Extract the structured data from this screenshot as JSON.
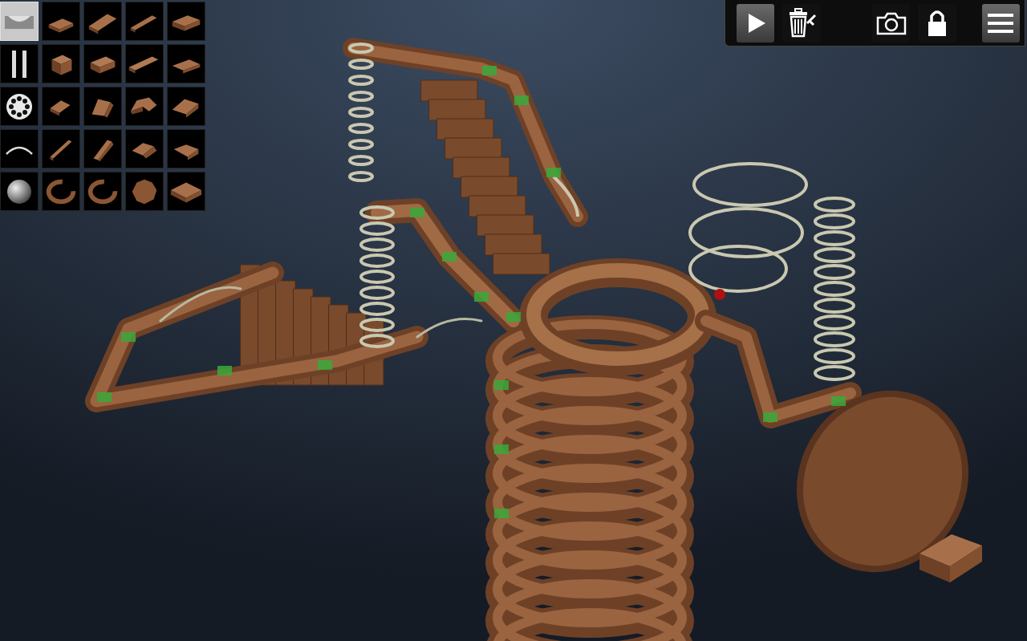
{
  "palette": {
    "categories": [
      {
        "kind": "track",
        "selected": true
      },
      {
        "kind": "rails",
        "selected": false
      },
      {
        "kind": "wheel",
        "selected": false
      },
      {
        "kind": "wire",
        "selected": false
      },
      {
        "kind": "ball",
        "selected": false
      }
    ],
    "pieces": [
      [
        "slab",
        "ramp",
        "bar",
        "tray"
      ],
      [
        "cube",
        "block",
        "beam",
        "wedge"
      ],
      [
        "corner",
        "bend",
        "arc",
        "fork"
      ],
      [
        "stick",
        "chute",
        "step",
        "spout"
      ],
      [
        "ring",
        "ring",
        "disc",
        "funnel"
      ]
    ]
  },
  "toolbar": {
    "buttons": [
      {
        "kind": "play",
        "active": false
      },
      {
        "kind": "trash",
        "active": false
      },
      {
        "kind": "camera",
        "active": false
      },
      {
        "kind": "lock",
        "active": true
      },
      {
        "kind": "menu",
        "active": false
      }
    ]
  }
}
